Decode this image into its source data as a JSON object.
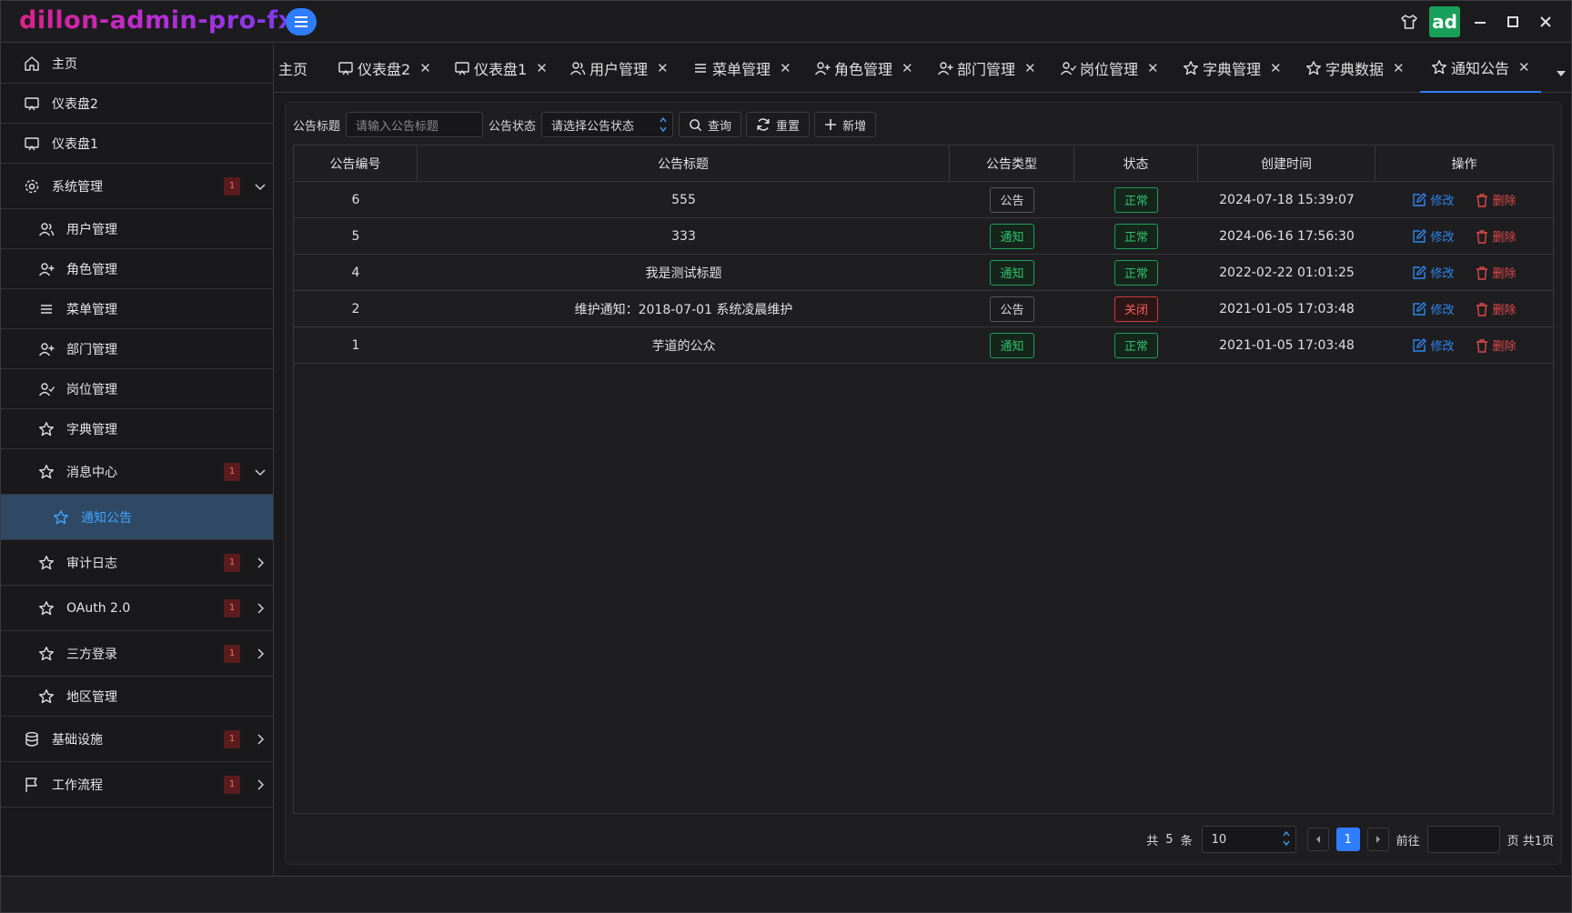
{
  "app": {
    "title": "dillon-admin-pro-fx",
    "avatar_text": "ad"
  },
  "colors": {
    "accent": "#2f7dff",
    "success": "#2ec16b",
    "danger": "#ff5b5b",
    "active_bg": "#2f4965"
  },
  "sidebar": {
    "items": [
      {
        "label": "主页",
        "icon": "home-icon"
      },
      {
        "label": "仪表盘2",
        "icon": "monitor-icon"
      },
      {
        "label": "仪表盘1",
        "icon": "monitor-icon"
      },
      {
        "label": "系统管理",
        "icon": "gear-icon",
        "badge": "1",
        "expanded": true
      },
      {
        "label": "用户管理",
        "icon": "users-icon"
      },
      {
        "label": "角色管理",
        "icon": "user-plus-icon"
      },
      {
        "label": "菜单管理",
        "icon": "list-icon"
      },
      {
        "label": "部门管理",
        "icon": "user-plus-icon"
      },
      {
        "label": "岗位管理",
        "icon": "user-check-icon"
      },
      {
        "label": "字典管理",
        "icon": "star-icon"
      },
      {
        "label": "消息中心",
        "icon": "star-icon",
        "badge": "1",
        "expanded": true
      },
      {
        "label": "通知公告",
        "icon": "star-icon",
        "active": true
      },
      {
        "label": "审计日志",
        "icon": "star-icon",
        "badge": "1"
      },
      {
        "label": "OAuth 2.0",
        "icon": "star-icon",
        "badge": "1"
      },
      {
        "label": "三方登录",
        "icon": "star-icon",
        "badge": "1"
      },
      {
        "label": "地区管理",
        "icon": "star-icon"
      },
      {
        "label": "基础设施",
        "icon": "database-icon",
        "badge": "1"
      },
      {
        "label": "工作流程",
        "icon": "flag-icon",
        "badge": "1"
      }
    ]
  },
  "tabs": [
    {
      "label": "主页"
    },
    {
      "label": "仪表盘2",
      "icon": "monitor-icon"
    },
    {
      "label": "仪表盘1",
      "icon": "monitor-icon"
    },
    {
      "label": "用户管理",
      "icon": "users-icon"
    },
    {
      "label": "菜单管理",
      "icon": "list-icon"
    },
    {
      "label": "角色管理",
      "icon": "user-plus-icon"
    },
    {
      "label": "部门管理",
      "icon": "user-plus-icon"
    },
    {
      "label": "岗位管理",
      "icon": "user-check-icon"
    },
    {
      "label": "字典管理",
      "icon": "star-icon"
    },
    {
      "label": "字典数据",
      "icon": "star-icon"
    },
    {
      "label": "通知公告",
      "icon": "star-icon",
      "active": true
    }
  ],
  "filters": {
    "title_label": "公告标题",
    "title_placeholder": "请输入公告标题",
    "status_label": "公告状态",
    "status_placeholder": "请选择公告状态",
    "search_button": "查询",
    "reset_button": "重置",
    "add_button": "新增"
  },
  "table": {
    "headers": [
      "公告编号",
      "公告标题",
      "公告类型",
      "状态",
      "创建时间",
      "操作"
    ],
    "edit_label": "修改",
    "delete_label": "删除",
    "rows": [
      {
        "id": "6",
        "title": "555",
        "type": "公告",
        "status": "正常",
        "created": "2024-07-18 15:39:07"
      },
      {
        "id": "5",
        "title": "333",
        "type": "通知",
        "status": "正常",
        "created": "2024-06-16 17:56:30"
      },
      {
        "id": "4",
        "title": "我是测试标题",
        "type": "通知",
        "status": "正常",
        "created": "2022-02-22 01:01:25"
      },
      {
        "id": "2",
        "title": "维护通知：2018-07-01 系统凌晨维护",
        "type": "公告",
        "status": "关闭",
        "created": "2021-01-05 17:03:48"
      },
      {
        "id": "1",
        "title": "芋道的公众",
        "type": "通知",
        "status": "正常",
        "created": "2021-01-05 17:03:48"
      }
    ]
  },
  "pagination": {
    "total_prefix": "共",
    "total": "5",
    "total_suffix": "条",
    "page_size": "10",
    "current_page": "1",
    "goto_label": "前往",
    "pages_suffix": "页 共1页"
  }
}
